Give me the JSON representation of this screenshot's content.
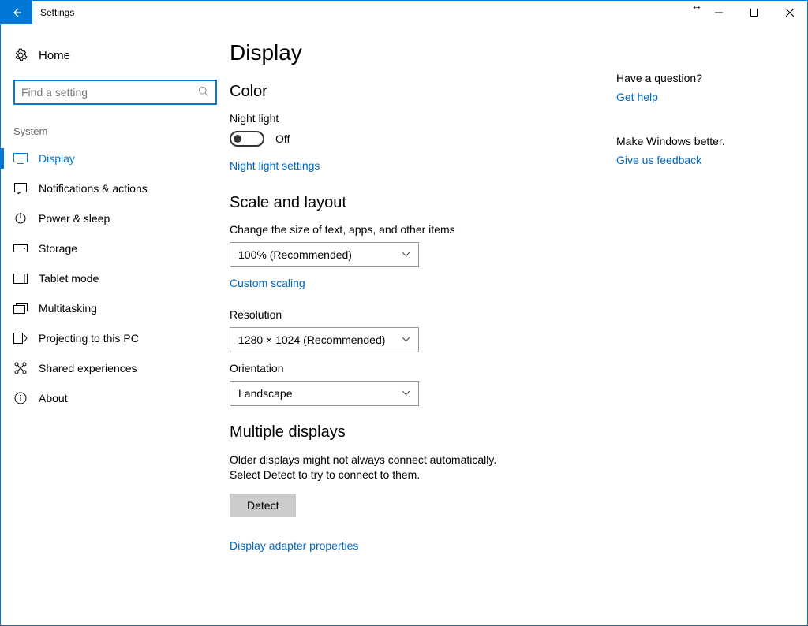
{
  "window": {
    "title": "Settings"
  },
  "sidebar": {
    "home": "Home",
    "search_placeholder": "Find a setting",
    "section": "System",
    "items": [
      {
        "label": "Display"
      },
      {
        "label": "Notifications & actions"
      },
      {
        "label": "Power & sleep"
      },
      {
        "label": "Storage"
      },
      {
        "label": "Tablet mode"
      },
      {
        "label": "Multitasking"
      },
      {
        "label": "Projecting to this PC"
      },
      {
        "label": "Shared experiences"
      },
      {
        "label": "About"
      }
    ]
  },
  "main": {
    "title": "Display",
    "color": {
      "heading": "Color",
      "night_light_label": "Night light",
      "night_light_state": "Off",
      "night_light_settings": "Night light settings"
    },
    "scale": {
      "heading": "Scale and layout",
      "scale_label": "Change the size of text, apps, and other items",
      "scale_value": "100% (Recommended)",
      "custom_scaling": "Custom scaling",
      "resolution_label": "Resolution",
      "resolution_value": "1280 × 1024 (Recommended)",
      "orientation_label": "Orientation",
      "orientation_value": "Landscape"
    },
    "multiple": {
      "heading": "Multiple displays",
      "text": "Older displays might not always connect automatically. Select Detect to try to connect to them.",
      "detect": "Detect",
      "adapter": "Display adapter properties"
    }
  },
  "aside": {
    "question": "Have a question?",
    "help": "Get help",
    "better": "Make Windows better.",
    "feedback": "Give us feedback"
  }
}
